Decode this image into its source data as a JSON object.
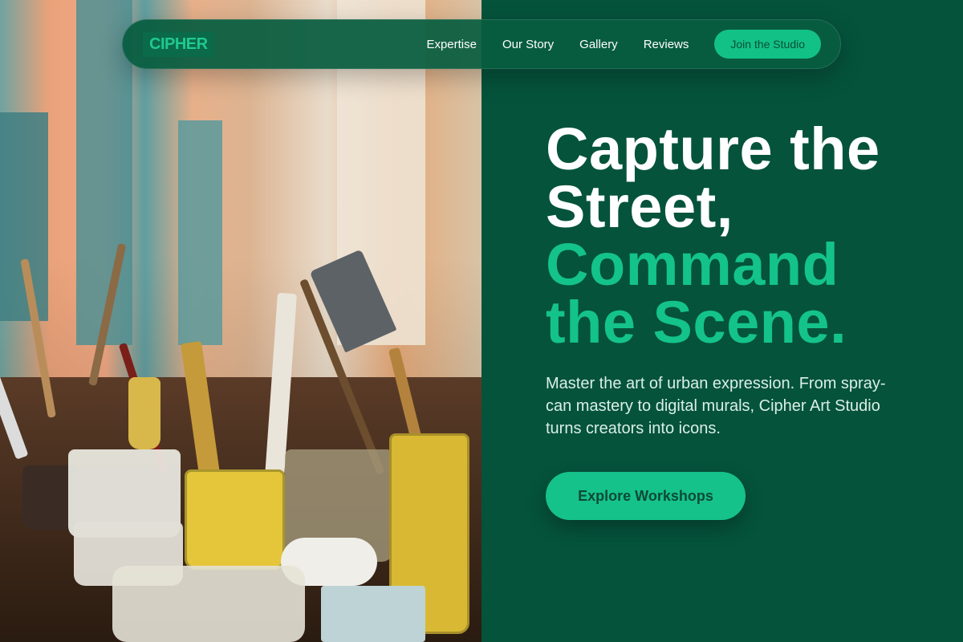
{
  "nav": {
    "logo": "CIPHER",
    "links": [
      "Expertise",
      "Our Story",
      "Gallery",
      "Reviews"
    ],
    "cta": "Join the Studio"
  },
  "hero": {
    "headline_white": [
      "Capture the",
      "Street,"
    ],
    "headline_green": [
      "Command",
      "the Scene."
    ],
    "subtext": "Master the art of urban expression. From spray-can mastery to digital murals, Cipher Art Studio turns creators into icons.",
    "cta": "Explore Workshops"
  },
  "colors": {
    "panel_bg": "#05533b",
    "accent": "#14c389",
    "nav_bg": "#075c40"
  },
  "image": {
    "subject": "art-studio-photo"
  }
}
